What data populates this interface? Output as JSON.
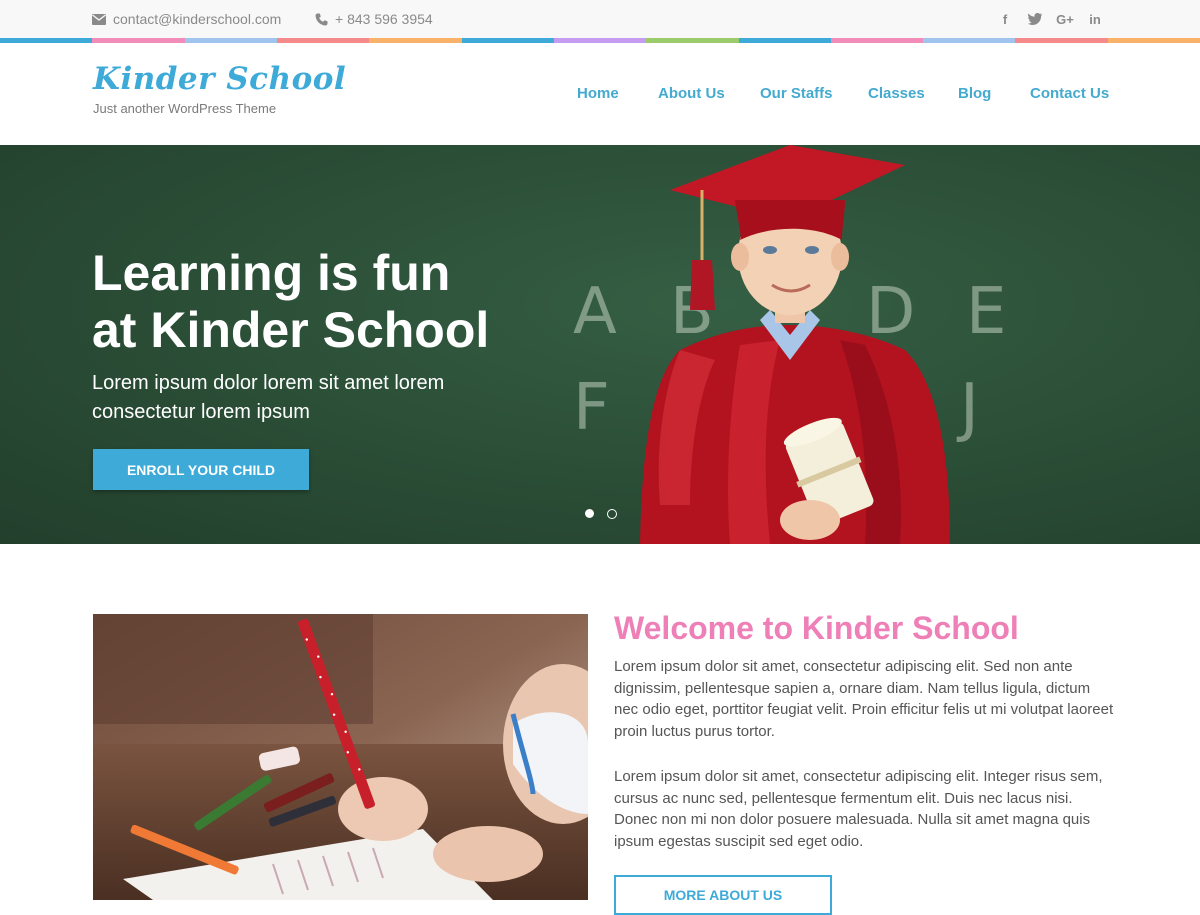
{
  "topbar": {
    "email": "contact@kinderschool.com",
    "phone": "+ 843 596 3954",
    "email_icon": "envelope-icon",
    "phone_icon": "phone-icon",
    "social": [
      {
        "name": "facebook-icon",
        "glyph": "f"
      },
      {
        "name": "twitter-icon",
        "glyph": "t"
      },
      {
        "name": "google-plus-icon",
        "glyph": "G+"
      },
      {
        "name": "linkedin-icon",
        "glyph": "in"
      }
    ],
    "stripe_colors": [
      "#3eaad8",
      "#f28cb8",
      "#9fc4ee",
      "#f58a8a",
      "#f8b26a",
      "#3eaad8",
      "#c59cf0",
      "#9bcb6a",
      "#3eaad8",
      "#f28cb8",
      "#9fc4ee",
      "#f58a8a",
      "#f8b26a"
    ]
  },
  "header": {
    "logo": "Kinder School",
    "tagline": "Just another WordPress Theme",
    "nav": [
      "Home",
      "About Us",
      "Our Staffs",
      "Classes",
      "Blog",
      "Contact Us"
    ]
  },
  "hero": {
    "title_line1": "Learning is fun",
    "title_line2": "at Kinder School",
    "subtitle": "Lorem ipsum dolor lorem sit amet lorem consectetur lorem ipsum",
    "button": "ENROLL YOUR CHILD",
    "chalk_letters": [
      "A",
      "B",
      "D",
      "E",
      "F",
      "J"
    ],
    "slides_count": 2,
    "active_slide": 1
  },
  "welcome": {
    "title": "Welcome to Kinder School",
    "paragraph1": "Lorem ipsum dolor sit amet, consectetur adipiscing elit. Sed non ante dignissim, pellentesque sapien a, ornare diam. Nam tellus ligula, dictum nec odio eget, porttitor feugiat velit. Proin efficitur felis ut mi volutpat laoreet proin luctus purus tortor.",
    "paragraph2": "Lorem ipsum dolor sit amet, consectetur adipiscing elit. Integer risus sem, cursus ac nunc sed, pellentesque fermentum elit. Duis nec lacus nisi. Donec non mi non dolor posuere malesuada. Nulla sit amet magna quis ipsum egestas suscipit sed eget odio.",
    "button": "MORE ABOUT US"
  },
  "colors": {
    "accent": "#3eaad8",
    "pink": "#ee7fb7",
    "hero_bg": "#2c5038"
  }
}
